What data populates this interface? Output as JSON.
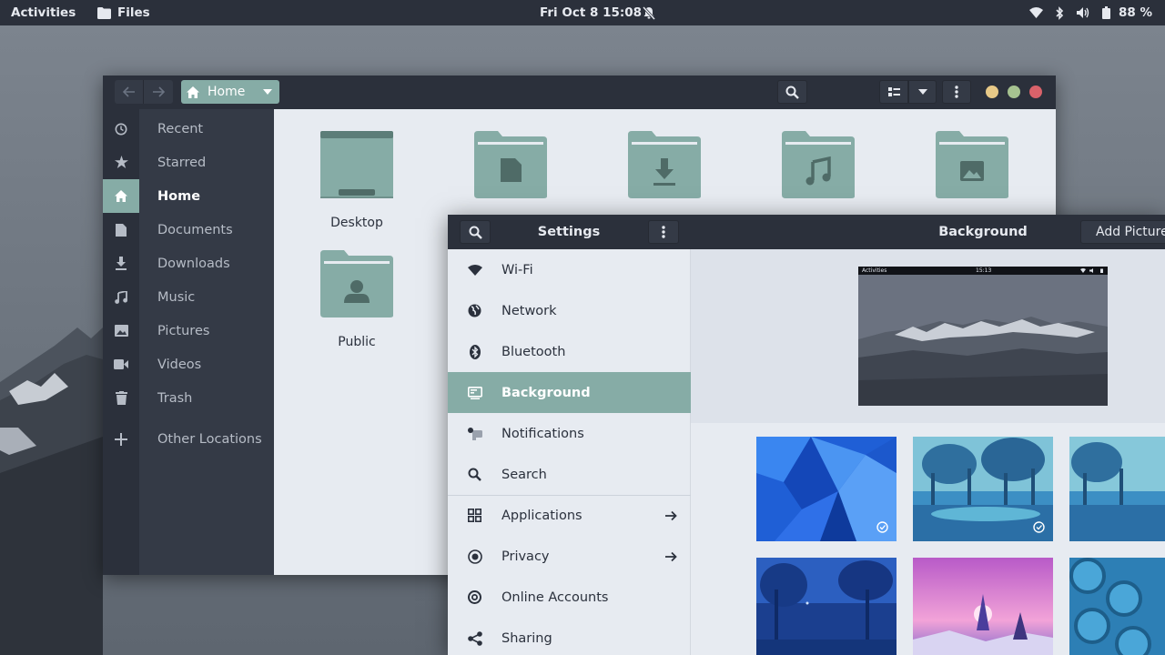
{
  "topbar": {
    "activities": "Activities",
    "app_name": "Files",
    "clock": "Fri Oct 8  15:08",
    "battery": "88 %"
  },
  "files": {
    "path_label": "Home",
    "sidebar": [
      {
        "label": "Recent",
        "icon": "clock-icon"
      },
      {
        "label": "Starred",
        "icon": "star-icon"
      },
      {
        "label": "Home",
        "icon": "home-icon",
        "active": true
      },
      {
        "label": "Documents",
        "icon": "document-icon"
      },
      {
        "label": "Downloads",
        "icon": "download-icon"
      },
      {
        "label": "Music",
        "icon": "music-icon"
      },
      {
        "label": "Pictures",
        "icon": "picture-icon"
      },
      {
        "label": "Videos",
        "icon": "video-icon"
      },
      {
        "label": "Trash",
        "icon": "trash-icon"
      },
      {
        "label": "Other Locations",
        "icon": "plus-icon"
      }
    ],
    "folders": [
      {
        "label": "Desktop",
        "icon": "desktop-folder-icon"
      },
      {
        "label": "Public",
        "icon": "public-folder-icon"
      }
    ],
    "window_controls": {
      "minimize": "#e8c987",
      "maximize": "#a6c290",
      "close": "#d9626a"
    }
  },
  "settings": {
    "title": "Settings",
    "panel_title": "Background",
    "add_picture": "Add Picture...",
    "preview_bar": {
      "left": "Activities",
      "center": "15:13"
    },
    "list": [
      {
        "label": "Wi-Fi",
        "icon": "wifi-icon"
      },
      {
        "label": "Network",
        "icon": "network-icon"
      },
      {
        "label": "Bluetooth",
        "icon": "bluetooth-icon"
      },
      {
        "label": "Background",
        "icon": "background-icon",
        "active": true
      },
      {
        "label": "Notifications",
        "icon": "notifications-icon"
      },
      {
        "label": "Search",
        "icon": "search-icon"
      },
      {
        "label": "Applications",
        "icon": "applications-icon",
        "arrow": true
      },
      {
        "label": "Privacy",
        "icon": "privacy-icon",
        "arrow": true
      },
      {
        "label": "Online Accounts",
        "icon": "online-accounts-icon"
      },
      {
        "label": "Sharing",
        "icon": "sharing-icon"
      }
    ]
  },
  "colors": {
    "accent": "#86aca6",
    "dark": "#2b303b",
    "sidebar": "#343a46",
    "content": "#e7ebf1"
  }
}
